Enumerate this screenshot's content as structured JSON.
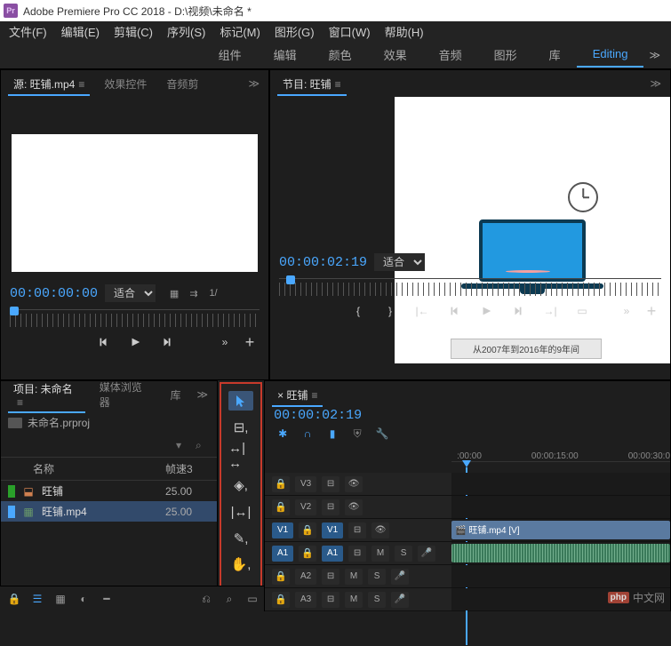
{
  "titlebar": {
    "logo": "Pr",
    "title": "Adobe Premiere Pro CC 2018 - D:\\视频\\未命名 *"
  },
  "menubar": {
    "items": [
      "文件(F)",
      "编辑(E)",
      "剪辑(C)",
      "序列(S)",
      "标记(M)",
      "图形(G)",
      "窗口(W)",
      "帮助(H)"
    ]
  },
  "workspace": {
    "items": [
      "组件",
      "编辑",
      "颜色",
      "效果",
      "音频",
      "图形",
      "库",
      "Editing"
    ],
    "active_index": 7
  },
  "source_panel": {
    "tabs": [
      "源: 旺铺.mp4",
      "效果控件",
      "音频剪"
    ],
    "active_index": 0,
    "timecode": "00:00:00:00",
    "fit_label": "适合",
    "extra": "1/"
  },
  "program_panel": {
    "tabs": [
      "节目: 旺铺"
    ],
    "active_index": 0,
    "timecode": "00:00:02:19",
    "fit_label": "适合",
    "caption": "从2007年到2016年的9年间"
  },
  "project_panel": {
    "tabs": [
      "项目: 未命名",
      "媒体浏览器",
      "库"
    ],
    "active_index": 0,
    "project_name": "未命名.prproj",
    "columns": {
      "name": "名称",
      "rate": "帧速3"
    },
    "items": [
      {
        "name": "旺铺",
        "rate": "25.00",
        "type": "sequence",
        "selected": false,
        "color": "#2aa02a"
      },
      {
        "name": "旺铺.mp4",
        "rate": "25.00",
        "type": "video",
        "selected": true,
        "color": "#4aa8ff"
      }
    ]
  },
  "tools": {
    "items": [
      "selection",
      "track-select",
      "ripple",
      "rate-stretch",
      "slip",
      "pen",
      "hand",
      "type"
    ],
    "active_index": 0
  },
  "timeline": {
    "sequence_name": "旺铺",
    "timecode": "00:00:02:19",
    "ruler": [
      ":00:00",
      "00:00:15:00",
      "00:00:30:0"
    ],
    "tool_icons": [
      "snap",
      "linked",
      "markers",
      "settings",
      "wrench"
    ],
    "video_tracks": [
      {
        "label": "V3",
        "clip": null
      },
      {
        "label": "V2",
        "clip": null
      },
      {
        "label": "V1",
        "on": true,
        "clip": "旺铺.mp4 [V]"
      }
    ],
    "audio_tracks": [
      {
        "label": "A1",
        "on": true,
        "clip": "audio"
      },
      {
        "label": "A2",
        "clip": null
      },
      {
        "label": "A3",
        "clip": null
      }
    ]
  },
  "watermark": {
    "badge": "php",
    "text": "中文网"
  }
}
